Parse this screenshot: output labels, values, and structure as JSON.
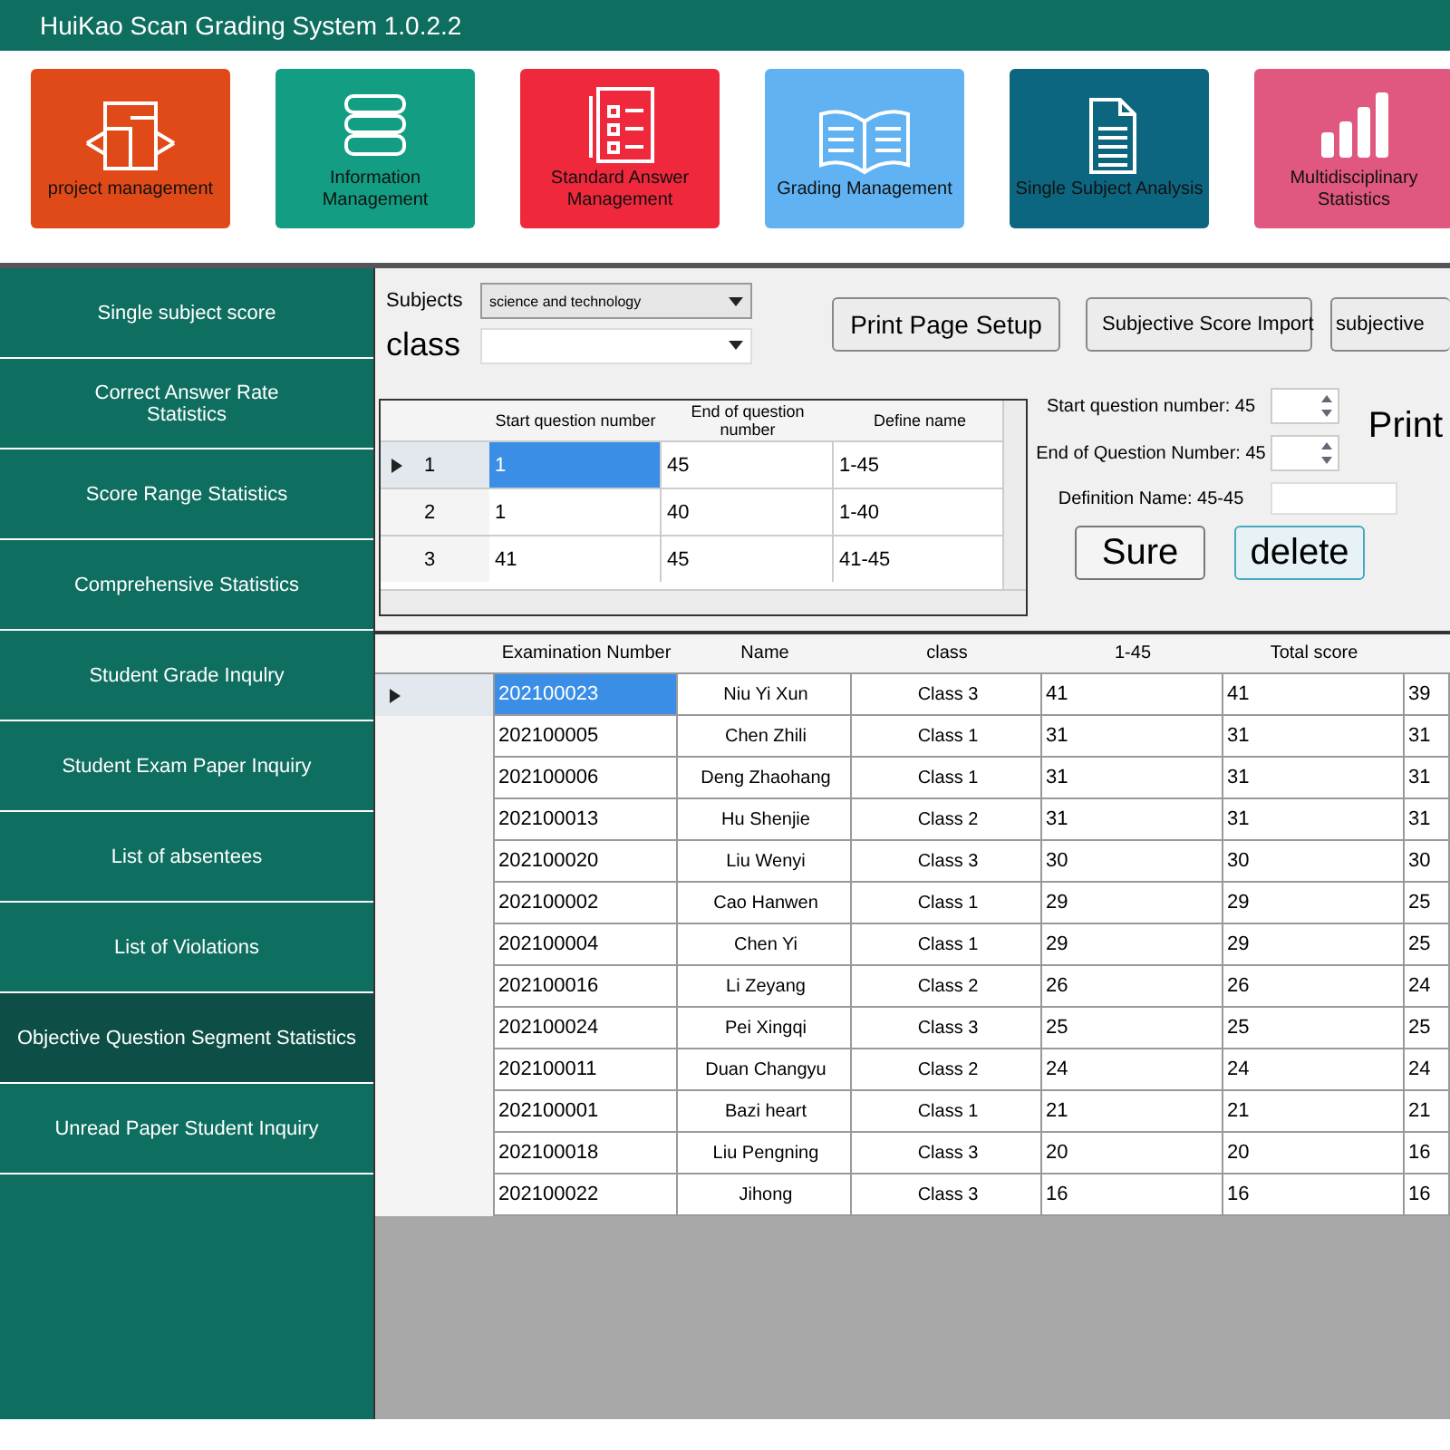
{
  "window": {
    "title": "HuiKao Scan Grading System 1.0.2.2"
  },
  "modules": [
    {
      "label": "project management",
      "kind": "plan",
      "color": "#e04a18"
    },
    {
      "label": "Information Management",
      "kind": "books",
      "color": "#139e83"
    },
    {
      "label": "Standard Answer Management",
      "kind": "checklist",
      "color": "#f0283c"
    },
    {
      "label": "Grading Management",
      "kind": "book",
      "color": "#60b2f2"
    },
    {
      "label": "Single Subject Analysis",
      "kind": "document",
      "color": "#0d6680"
    },
    {
      "label": "Multidisciplinary Statistics",
      "kind": "chart",
      "color": "#e0587f"
    }
  ],
  "sidebar": {
    "items": [
      {
        "label": "Single subject score",
        "selected": false
      },
      {
        "label": "Correct Answer Rate Statistics",
        "selected": false
      },
      {
        "label": "Score Range Statistics",
        "selected": false
      },
      {
        "label": "Comprehensive Statistics",
        "selected": false
      },
      {
        "label": "Student Grade Inqulry",
        "selected": false
      },
      {
        "label": "Student Exam Paper Inquiry",
        "selected": false
      },
      {
        "label": "List of absentees",
        "selected": false
      },
      {
        "label": "List of Violations",
        "selected": false
      },
      {
        "label": "Objective Question Segment Statistics",
        "selected": true
      },
      {
        "label": "Unread Paper Student Inquiry",
        "selected": false
      }
    ]
  },
  "filters": {
    "subjects_label": "Subjects",
    "subjects_value": "science and technology",
    "class_label": "class"
  },
  "toolbar": [
    "Print Page Setup",
    "Subjective Score Import",
    "subjective"
  ],
  "segments": {
    "columns": [
      "Start question number",
      "End of question number",
      "Define name"
    ],
    "rows": [
      {
        "index": "1",
        "start": "1",
        "end": "45",
        "name": "1-45",
        "selected": true
      },
      {
        "index": "2",
        "start": "1",
        "end": "40",
        "name": "1-40",
        "selected": false
      },
      {
        "index": "3",
        "start": "41",
        "end": "45",
        "name": "41-45",
        "selected": false
      }
    ]
  },
  "editor": {
    "start_label": "Start question number:",
    "start_value": "45",
    "end_label": "End of Question Number:",
    "end_value": "45",
    "name_label": "Definition Name:",
    "name_value": "45-45",
    "buttons": [
      "Sure",
      "delete"
    ],
    "print_label": "Print"
  },
  "results": {
    "columns": [
      "Examination Number",
      "Name",
      "class",
      "1-45",
      "Total score"
    ],
    "rows": [
      {
        "number": "202100023",
        "name": "Niu Yi Xun",
        "class": "Class 3",
        "score": "41",
        "total": "41",
        "column_7": "39",
        "selected": true
      },
      {
        "number": "202100005",
        "name": "Chen Zhili",
        "class": "Class 1",
        "score": "31",
        "total": "31",
        "column_7": "31",
        "selected": false
      },
      {
        "number": "202100006",
        "name": "Deng Zhaohang",
        "class": "Class 1",
        "score": "31",
        "total": "31",
        "column_7": "31",
        "selected": false
      },
      {
        "number": "202100013",
        "name": "Hu Shenjie",
        "class": "Class 2",
        "score": "31",
        "total": "31",
        "column_7": "31",
        "selected": false
      },
      {
        "number": "202100020",
        "name": "Liu Wenyi",
        "class": "Class 3",
        "score": "30",
        "total": "30",
        "column_7": "30",
        "selected": false
      },
      {
        "number": "202100002",
        "name": "Cao Hanwen",
        "class": "Class 1",
        "score": "29",
        "total": "29",
        "column_7": "25",
        "selected": false
      },
      {
        "number": "202100004",
        "name": "Chen Yi",
        "class": "Class 1",
        "score": "29",
        "total": "29",
        "column_7": "25",
        "selected": false
      },
      {
        "number": "202100016",
        "name": "Li Zeyang",
        "class": "Class 2",
        "score": "26",
        "total": "26",
        "column_7": "24",
        "selected": false
      },
      {
        "number": "202100024",
        "name": "Pei Xingqi",
        "class": "Class 3",
        "score": "25",
        "total": "25",
        "column_7": "25",
        "selected": false
      },
      {
        "number": "202100011",
        "name": "Duan Changyu",
        "class": "Class 2",
        "score": "24",
        "total": "24",
        "column_7": "24",
        "selected": false
      },
      {
        "number": "202100001",
        "name": "Bazi heart",
        "class": "Class 1",
        "score": "21",
        "total": "21",
        "column_7": "21",
        "selected": false
      },
      {
        "number": "202100018",
        "name": "Liu Pengning",
        "class": "Class 3",
        "score": "20",
        "total": "20",
        "column_7": "16",
        "selected": false
      },
      {
        "number": "202100022",
        "name": "Jihong",
        "class": "Class 3",
        "score": "16",
        "total": "16",
        "column_7": "16",
        "selected": false
      }
    ]
  }
}
